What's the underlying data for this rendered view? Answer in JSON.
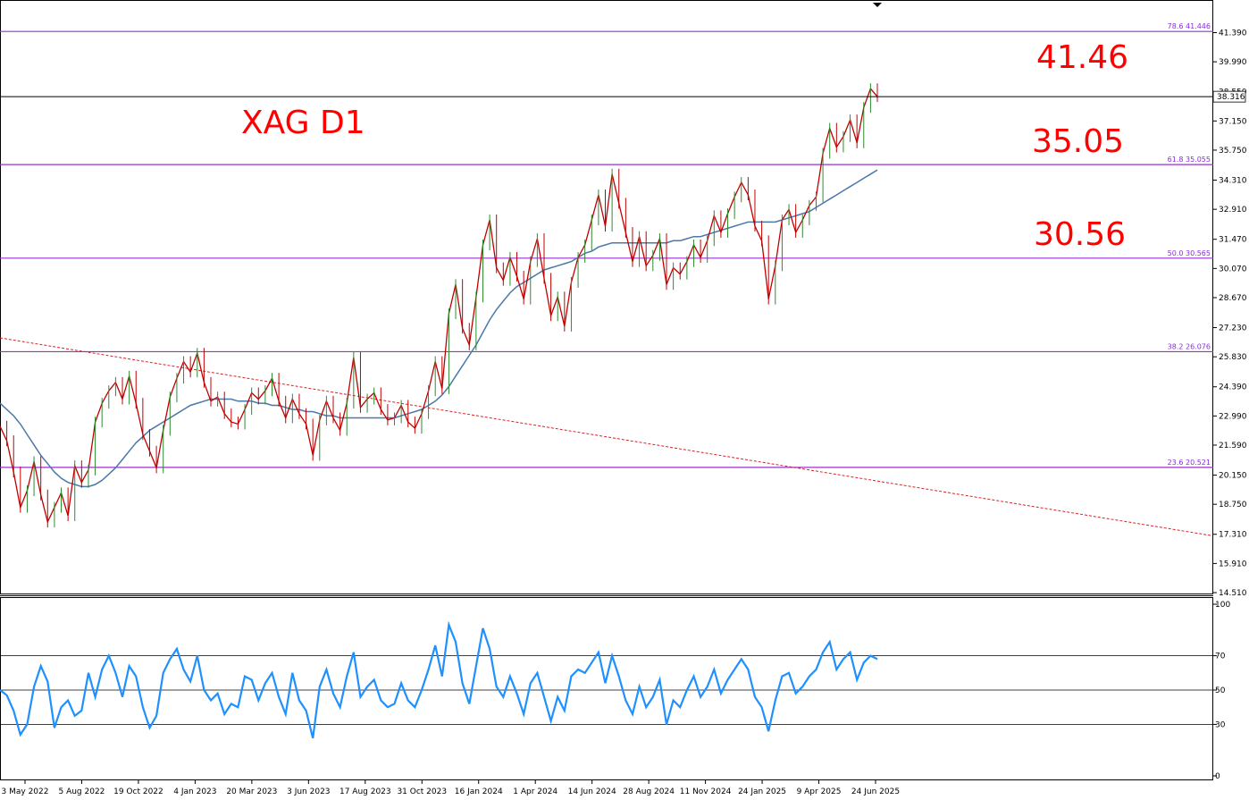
{
  "chart_data": {
    "type": "line",
    "title": "XAG D1",
    "price_axis": {
      "ticks": [
        "41.390",
        "39.990",
        "38.550",
        "37.150",
        "35.750",
        "34.310",
        "32.910",
        "31.470",
        "30.070",
        "28.670",
        "27.230",
        "25.830",
        "24.390",
        "22.990",
        "21.590",
        "20.150",
        "18.750",
        "17.310",
        "15.910",
        "14.510"
      ],
      "range": [
        14.51,
        42.79
      ]
    },
    "current_price": {
      "value": 38.316,
      "label": "38.316"
    },
    "fib_levels": [
      {
        "label": "78.6 41.446",
        "value": 41.446
      },
      {
        "label": "61.8 35.055",
        "value": 35.055
      },
      {
        "label": "50.0 30.565",
        "value": 30.565
      },
      {
        "label": "38.2 26.076",
        "value": 26.076
      },
      {
        "label": "23.6 20.521",
        "value": 20.521
      }
    ],
    "targets": [
      {
        "label": "41.46",
        "value": 41.46
      },
      {
        "label": "35.05",
        "value": 35.05
      },
      {
        "label": "30.56",
        "value": 30.56
      }
    ],
    "x_dates": [
      "3 May 2022",
      "5 Aug 2022",
      "19 Oct 2022",
      "4 Jan 2023",
      "20 Mar 2023",
      "3 Jun 2023",
      "17 Aug 2023",
      "31 Oct 2023",
      "16 Jan 2024",
      "1 Apr 2024",
      "14 Jun 2024",
      "28 Aug 2024",
      "11 Nov 2024",
      "24 Jan 2025",
      "9 Apr 2025",
      "24 Jun 2025"
    ],
    "price_series": [
      22.5,
      21.8,
      20.3,
      18.6,
      19.4,
      20.8,
      19.2,
      17.9,
      18.6,
      19.3,
      18.2,
      20.6,
      19.8,
      20.4,
      22.7,
      23.6,
      24.2,
      24.6,
      23.8,
      24.9,
      23.6,
      22.1,
      21.3,
      20.5,
      22.3,
      23.9,
      24.8,
      25.6,
      25.1,
      26.0,
      24.6,
      23.7,
      23.9,
      23.1,
      22.7,
      22.6,
      23.3,
      24.1,
      23.8,
      24.2,
      24.8,
      23.7,
      22.9,
      23.8,
      23.1,
      22.6,
      21.1,
      22.8,
      23.7,
      22.9,
      22.3,
      23.6,
      25.8,
      23.4,
      23.8,
      24.1,
      23.3,
      22.8,
      22.9,
      23.5,
      22.7,
      22.4,
      23.1,
      24.2,
      25.6,
      24.3,
      27.9,
      29.3,
      27.2,
      26.4,
      28.7,
      31.2,
      32.4,
      30.1,
      29.5,
      30.6,
      29.7,
      28.6,
      30.4,
      31.5,
      29.6,
      27.8,
      28.7,
      27.3,
      29.4,
      30.6,
      31.2,
      32.4,
      33.6,
      32.1,
      34.6,
      33.2,
      31.8,
      30.4,
      31.6,
      30.2,
      30.7,
      31.5,
      29.3,
      30.1,
      29.8,
      30.4,
      31.2,
      30.6,
      31.4,
      32.6,
      31.8,
      32.7,
      33.5,
      34.2,
      33.6,
      32.1,
      31.4,
      28.6,
      30.2,
      32.4,
      32.9,
      31.8,
      32.4,
      33.1,
      33.5,
      35.6,
      36.8,
      35.9,
      36.4,
      37.2,
      36.1,
      37.8,
      38.7,
      38.316
    ],
    "ma_series": [
      23.6,
      23.3,
      23.0,
      22.6,
      22.1,
      21.6,
      21.1,
      20.7,
      20.3,
      20.0,
      19.8,
      19.7,
      19.6,
      19.6,
      19.7,
      19.9,
      20.2,
      20.5,
      20.9,
      21.3,
      21.7,
      22.0,
      22.3,
      22.5,
      22.7,
      22.9,
      23.1,
      23.3,
      23.5,
      23.6,
      23.7,
      23.8,
      23.8,
      23.8,
      23.8,
      23.7,
      23.7,
      23.7,
      23.6,
      23.6,
      23.5,
      23.5,
      23.4,
      23.3,
      23.3,
      23.2,
      23.2,
      23.1,
      23.0,
      23.0,
      22.9,
      22.9,
      22.9,
      22.9,
      22.9,
      22.9,
      22.9,
      22.9,
      22.9,
      23.0,
      23.1,
      23.2,
      23.3,
      23.5,
      23.7,
      24.0,
      24.4,
      24.9,
      25.4,
      25.9,
      26.4,
      27.0,
      27.6,
      28.1,
      28.5,
      28.9,
      29.2,
      29.4,
      29.6,
      29.8,
      30.0,
      30.1,
      30.2,
      30.3,
      30.4,
      30.6,
      30.8,
      30.9,
      31.1,
      31.2,
      31.3,
      31.3,
      31.3,
      31.3,
      31.3,
      31.3,
      31.3,
      31.3,
      31.3,
      31.4,
      31.4,
      31.5,
      31.6,
      31.6,
      31.7,
      31.8,
      31.9,
      32.0,
      32.1,
      32.2,
      32.3,
      32.3,
      32.3,
      32.3,
      32.3,
      32.4,
      32.5,
      32.6,
      32.7,
      32.8,
      33.0,
      33.2,
      33.4,
      33.6,
      33.8,
      34.0,
      34.2,
      34.4,
      34.6,
      34.8
    ],
    "rsi": {
      "ticks": [
        "100",
        "70",
        "50",
        "30",
        "0"
      ],
      "range": [
        0,
        100
      ],
      "levels": [
        70,
        50,
        30
      ],
      "values": [
        50,
        47,
        38,
        24,
        30,
        52,
        64,
        55,
        28,
        40,
        44,
        35,
        38,
        60,
        46,
        62,
        70,
        60,
        46,
        64,
        58,
        40,
        28,
        35,
        60,
        68,
        74,
        62,
        55,
        70,
        50,
        44,
        48,
        36,
        42,
        40,
        58,
        56,
        44,
        54,
        60,
        46,
        36,
        60,
        44,
        38,
        22,
        52,
        62,
        48,
        40,
        58,
        72,
        46,
        52,
        56,
        44,
        40,
        42,
        54,
        44,
        40,
        50,
        62,
        76,
        58,
        88,
        78,
        54,
        42,
        64,
        86,
        74,
        52,
        46,
        58,
        48,
        36,
        54,
        60,
        46,
        32,
        46,
        38,
        58,
        62,
        60,
        66,
        72,
        54,
        70,
        58,
        44,
        36,
        52,
        40,
        46,
        56,
        30,
        44,
        40,
        50,
        58,
        46,
        52,
        62,
        48,
        56,
        62,
        68,
        62,
        46,
        40,
        26,
        44,
        58,
        60,
        48,
        52,
        58,
        62,
        72,
        78,
        62,
        68,
        72,
        56,
        66,
        70,
        68
      ]
    },
    "grid": false
  }
}
